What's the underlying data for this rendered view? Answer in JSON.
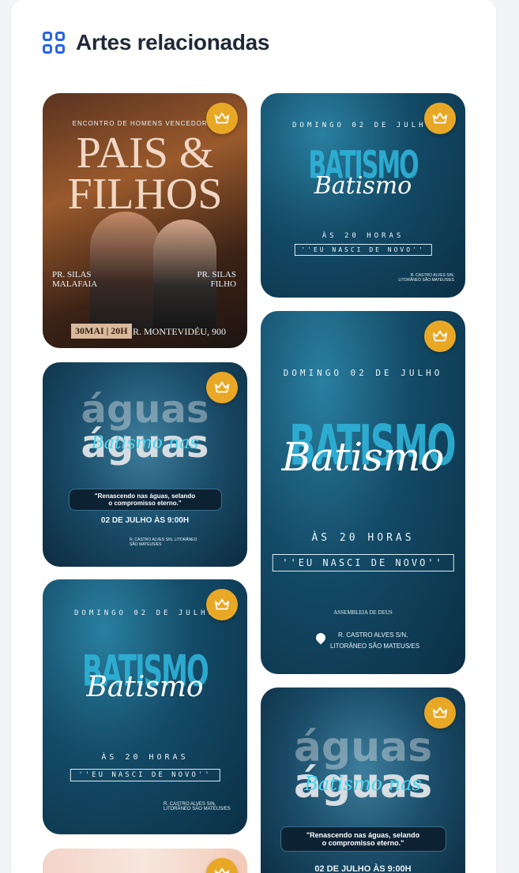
{
  "header": {
    "title": "Artes relacionadas",
    "icon": "grid-icon"
  },
  "accent_color": "#2563eb",
  "crown_color": "#e8a826",
  "cards": {
    "pais": {
      "top_line": "ENCONTRO DE HOMENS VENCEDORES",
      "title_line1": "PAIS &",
      "title_line2": "FILHOS",
      "left_name": "PR. SILAS MALAFAIA",
      "right_name": "PR. SILAS FILHO",
      "date_time": "30MAI | 20H",
      "address": "R. MONTEVIDÉU, 900"
    },
    "batismo_small": {
      "date": "DOMINGO 02 DE JULHO",
      "big": "BATISMO",
      "script": "Batismo",
      "time": "ÀS 20 HORAS",
      "slogan": "''EU NASCI DE NOVO''",
      "address": "R. CASTRO ALVES S/N, LITORÂNEO SÃO MATEUS/ES"
    },
    "batismo_tall": {
      "date": "DOMINGO 02 DE JULHO",
      "big": "BATISMO",
      "script": "Batismo",
      "time": "ÀS 20 HORAS",
      "slogan": "''EU NASCI DE NOVO''",
      "church": "ASSEMBLEIA DE DEUS",
      "address_line1": "R. CASTRO ALVES S/N,",
      "address_line2": "LITORÂNEO SÃO MATEUS/ES"
    },
    "aguas": {
      "word": "águas",
      "script": "Batismo nas",
      "quote_line1": "\"Renascendo nas águas, selando",
      "quote_line2": "o compromisso eterno.\"",
      "date": "02 DE JULHO ÀS 9:00H",
      "address": "R. CASTRO ALVES S/N, LITORÂNEO SÃO MATEUS/ES"
    },
    "batismo_third": {
      "date": "DOMINGO 02 DE JULHO",
      "big": "BATISMO",
      "script": "Batismo",
      "time": "ÀS 20 HORAS",
      "slogan": "''EU NASCI DE NOVO''",
      "address": "R. CASTRO ALVES S/N, LITORÂNEO SÃO MATEUS/ES"
    },
    "aguas2": {
      "word": "águas",
      "script": "Batismo nas",
      "quote_line1": "\"Renascendo nas águas, selando",
      "quote_line2": "o compromisso eterno.\"",
      "date": "02 DE JULHO ÀS 9:00H"
    }
  }
}
